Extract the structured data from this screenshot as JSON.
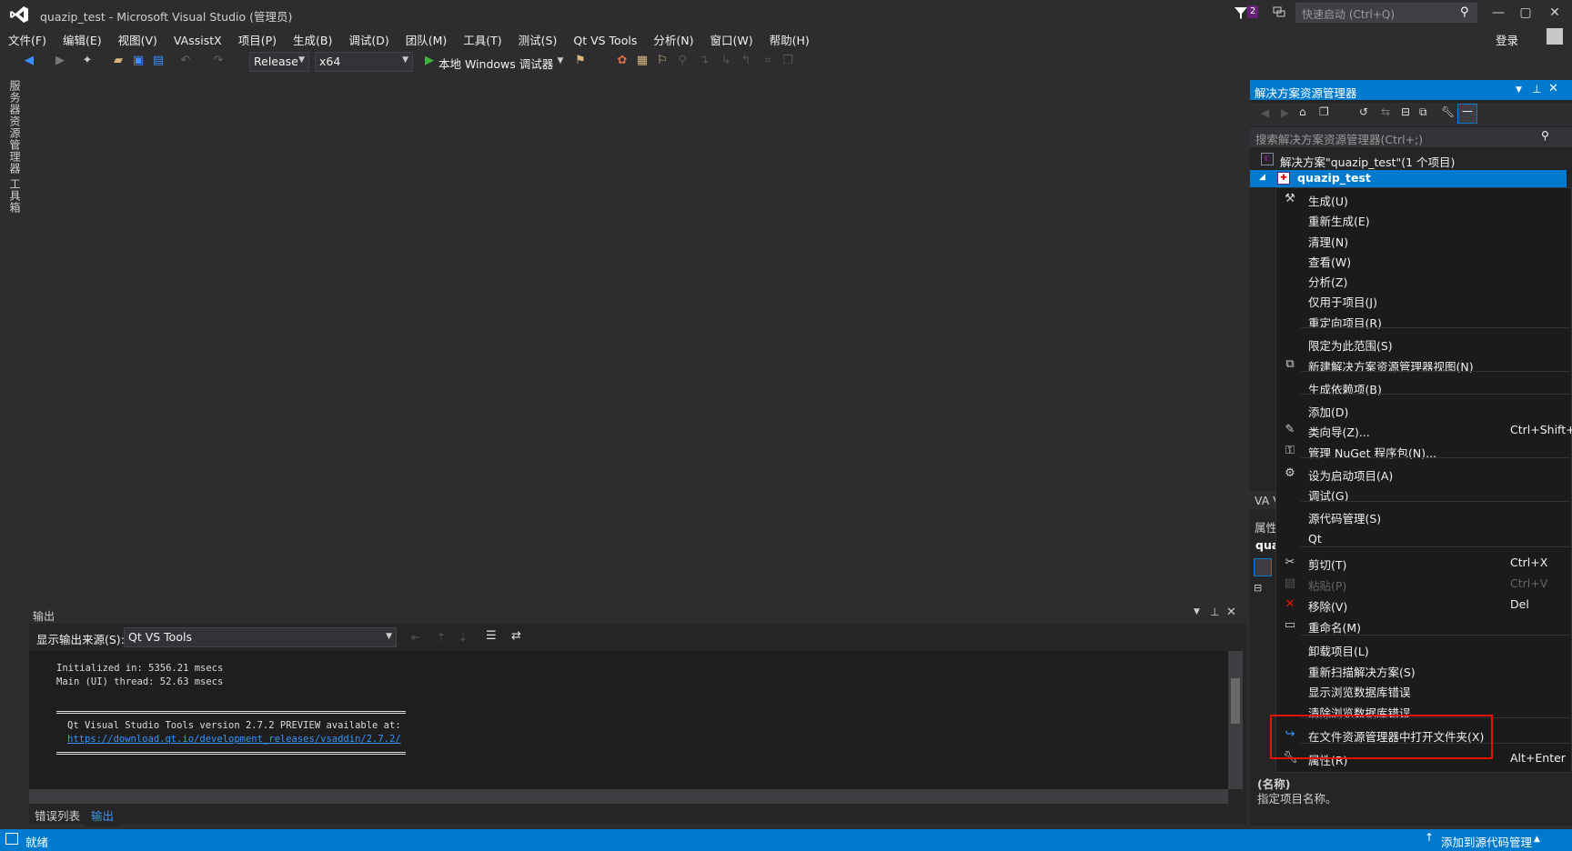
{
  "window": {
    "title": "quazip_test - Microsoft Visual Studio (管理员)",
    "filter_badge": "2",
    "quick_launch_placeholder": "快速启动 (Ctrl+Q)",
    "login": "登录"
  },
  "menu": [
    "文件(F)",
    "编辑(E)",
    "视图(V)",
    "VAssistX",
    "项目(P)",
    "生成(B)",
    "调试(D)",
    "团队(M)",
    "工具(T)",
    "测试(S)",
    "Qt VS Tools",
    "分析(N)",
    "窗口(W)",
    "帮助(H)"
  ],
  "toolbar": {
    "config": "Release",
    "platform": "x64",
    "run_label": "本地 Windows 调试器"
  },
  "left_tabs": [
    "服务器资源管理器",
    "工具箱"
  ],
  "output": {
    "title": "输出",
    "source_label": "显示输出来源(S):",
    "source_value": "Qt VS Tools",
    "lines": [
      "Initialized in: 5356.21 msecs",
      "Main (UI) thread: 52.63 msecs"
    ],
    "notice_line": "Qt Visual Studio Tools version 2.7.2 PREVIEW available at:",
    "notice_link": "https://download.qt.io/development_releases/vsaddin/2.7.2/",
    "tabs": [
      "错误列表",
      "输出"
    ]
  },
  "solution_explorer": {
    "title": "解决方案资源管理器",
    "search_placeholder": "搜索解决方案资源管理器(Ctrl+;)",
    "solution": "解决方案\"quazip_test\"(1 个项目)",
    "project": "quazip_test"
  },
  "properties": {
    "va_frag": "VA V",
    "title_frag": "属性",
    "obj_frag": "qua",
    "name_label": "(名称)",
    "name_desc": "指定项目名称。"
  },
  "context_menu": [
    {
      "label": "生成(U)",
      "shortcut": "",
      "icon": "build-icon"
    },
    {
      "label": "重新生成(E)",
      "shortcut": "",
      "icon": ""
    },
    {
      "label": "清理(N)",
      "shortcut": "",
      "icon": ""
    },
    {
      "label": "查看(W)",
      "shortcut": "",
      "icon": ""
    },
    {
      "label": "分析(Z)",
      "shortcut": "",
      "icon": ""
    },
    {
      "label": "仅用于项目(J)",
      "shortcut": "",
      "icon": ""
    },
    {
      "label": "重定向项目(R)",
      "shortcut": "",
      "icon": ""
    },
    {
      "label": "限定为此范围(S)",
      "shortcut": "",
      "icon": ""
    },
    {
      "label": "新建解决方案资源管理器视图(N)",
      "shortcut": "",
      "icon": "new-view-icon"
    },
    {
      "label": "生成依赖项(B)",
      "shortcut": "",
      "icon": ""
    },
    {
      "label": "添加(D)",
      "shortcut": "",
      "icon": ""
    },
    {
      "label": "类向导(Z)...",
      "shortcut": "Ctrl+Shift+X",
      "icon": "class-wizard-icon"
    },
    {
      "label": "管理 NuGet 程序包(N)...",
      "shortcut": "",
      "icon": "nuget-icon"
    },
    {
      "label": "设为启动项目(A)",
      "shortcut": "",
      "icon": "gear-icon"
    },
    {
      "label": "调试(G)",
      "shortcut": "",
      "icon": ""
    },
    {
      "label": "源代码管理(S)",
      "shortcut": "",
      "icon": ""
    },
    {
      "label": "Qt",
      "shortcut": "",
      "icon": ""
    },
    {
      "label": "剪切(T)",
      "shortcut": "Ctrl+X",
      "icon": "scissors-icon"
    },
    {
      "label": "粘贴(P)",
      "shortcut": "Ctrl+V",
      "icon": "paste-icon"
    },
    {
      "label": "移除(V)",
      "shortcut": "Del",
      "icon": "remove-icon"
    },
    {
      "label": "重命名(M)",
      "shortcut": "",
      "icon": "rename-icon"
    },
    {
      "label": "卸载项目(L)",
      "shortcut": "",
      "icon": ""
    },
    {
      "label": "重新扫描解决方案(S)",
      "shortcut": "",
      "icon": ""
    },
    {
      "label": "显示浏览数据库错误",
      "shortcut": "",
      "icon": ""
    },
    {
      "label": "清除浏览数据库错误",
      "shortcut": "",
      "icon": ""
    },
    {
      "label": "在文件资源管理器中打开文件夹(X)",
      "shortcut": "",
      "icon": "open-folder-arrow-icon"
    },
    {
      "label": "属性(R)",
      "shortcut": "Alt+Enter",
      "icon": "wrench-icon"
    }
  ],
  "status": {
    "left": "就绪",
    "right": "添加到源代码管理"
  },
  "colors": {
    "accent": "#007acc",
    "highlight_box": "#e51400"
  }
}
